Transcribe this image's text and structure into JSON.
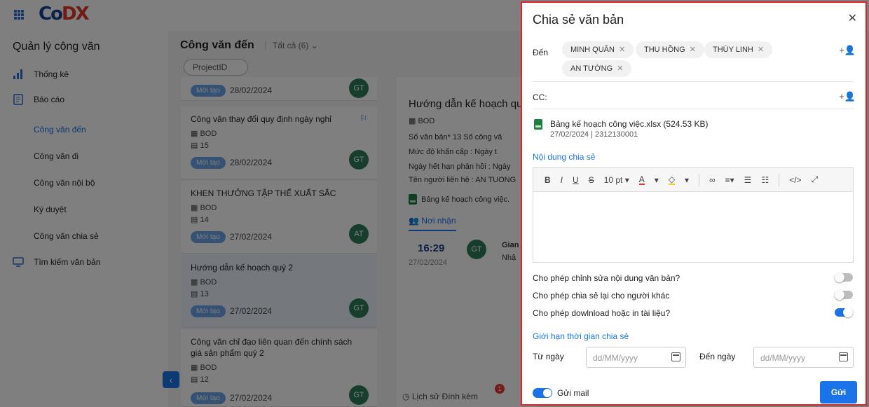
{
  "app": {
    "logo": {
      "part1": "Co",
      "part2": "DX"
    },
    "sidebar": {
      "title": "Quản lý công văn",
      "items": [
        {
          "label": "Thống kê",
          "icon": "bar-chart-icon"
        },
        {
          "label": "Báo cáo",
          "icon": "report-icon"
        }
      ],
      "sub_items": [
        "Công văn đến",
        "Công văn đi",
        "Công văn nội bộ",
        "Ký duyệt",
        "Công văn chia sẻ"
      ],
      "search": {
        "label": "Tìm kiếm văn bản",
        "icon": "monitor-search-icon"
      }
    },
    "list": {
      "title": "Công văn đến",
      "filter": "Tất cả (6) ⌄",
      "search_pill": "ProjectID",
      "cards": [
        {
          "status": "Mới tạo",
          "date": "28/02/2024",
          "avatar": "GT"
        },
        {
          "title": "Công văn thay đổi quy định ngày nghỉ",
          "unit": "BOD",
          "number": "15",
          "status": "Mới tạo",
          "date": "28/02/2024",
          "avatar": "GT"
        },
        {
          "title": "KHEN THƯỞNG TẬP THỂ XUẤT SẮC",
          "unit": "BOD",
          "number": "14",
          "status": "Mới tạo",
          "date": "27/02/2024",
          "avatar": "AT"
        },
        {
          "title": "Hướng dẫn kế hoạch quý 2",
          "unit": "BOD",
          "number": "13",
          "status": "Mới tạo",
          "date": "27/02/2024",
          "avatar": "GT"
        },
        {
          "title": "Công văn chỉ đạo liên quan đến chính sách giá sản phẩm quý 2",
          "unit": "BOD",
          "number": "12",
          "status": "Mới tạo",
          "date": "27/02/2024",
          "avatar": "GT"
        }
      ]
    },
    "detail": {
      "title": "Hướng dẫn kế hoạch qu",
      "unit": "BOD",
      "line1": "Số văn bản* 13   Số công vă",
      "line2": "Mức độ khẩn cấp :      Ngày t",
      "line3": "Ngày hết hạn phản hồi :  Ngày",
      "line4": "Tên người liên hệ :  AN TUONG",
      "file": "Bảng kế hoạch công việc.",
      "tab": "Nơi nhận",
      "time": "16:29",
      "time_date": "27/02/2024",
      "recipient_avatar": "GT",
      "recipient_name": "Gian",
      "recipient_sub": "Nhậ",
      "footer": "Lịch sử    Đính kèm",
      "attach_count": "1"
    }
  },
  "dialog": {
    "title": "Chia sẻ văn bản",
    "to_label": "Đến",
    "to_chips": [
      "MINH QUÂN",
      "THU HỒNG",
      "THÙY LINH",
      "AN TƯỜNG"
    ],
    "cc_label": "CC:",
    "attachment": {
      "name": "Bảng kế hoạch công việc.xlsx (524.53 KB)",
      "meta": "27/02/2024 | 2312130001"
    },
    "content_label": "Nội dung chia sẻ",
    "editor_toolbar": {
      "font_size": "10 pt"
    },
    "options": [
      {
        "label": "Cho phép chỉnh sửa nội dung văn bản?",
        "on": false
      },
      {
        "label": "Cho phép chia sẻ lại cho người khác",
        "on": false
      },
      {
        "label": "Cho phép dowlnload hoặc in tài liệu?",
        "on": true
      }
    ],
    "time_limit_label": "Giới hạn thời gian chia sẻ",
    "from_label": "Từ ngày",
    "to_date_label": "Đến ngày",
    "date_placeholder": "dd/MM/yyyy",
    "send_mail_label": "Gửi mail",
    "send_mail_on": true,
    "send_button": "Gửi"
  },
  "colors": {
    "accent": "#1a73e8",
    "highlight_border": "#e3242b",
    "avatar": "#2e7d5b"
  }
}
